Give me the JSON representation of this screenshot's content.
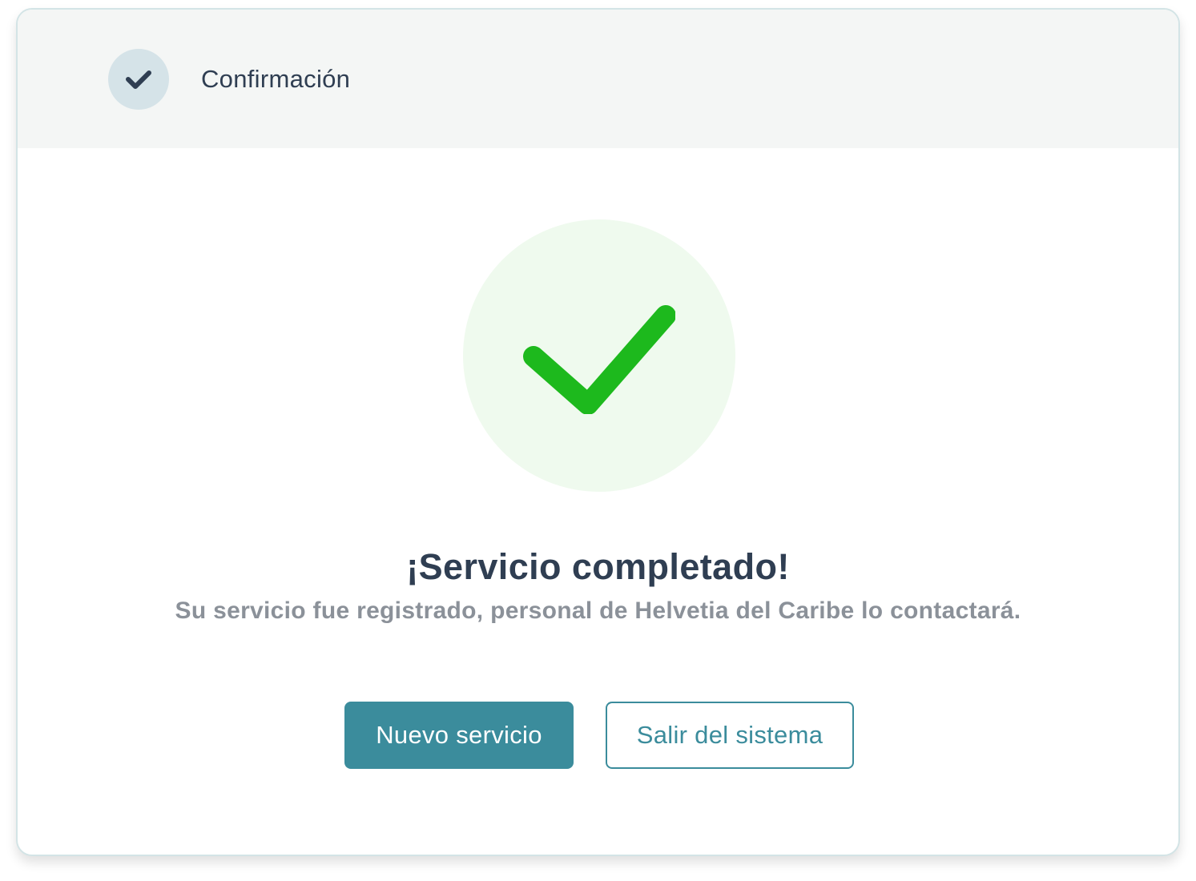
{
  "header": {
    "step_label": "Confirmación",
    "step_icon": "check-icon",
    "badge_color": "#d5e3e8",
    "icon_color": "#2f3e52"
  },
  "main": {
    "success_icon": "check-icon",
    "success_color": "#1db91d",
    "success_bg": "#effaee",
    "title": "¡Servicio completado!",
    "subtitle": "Su servicio fue registrado, personal de Helvetia del Caribe lo contactará."
  },
  "actions": {
    "primary_label": "Nuevo servicio",
    "secondary_label": "Salir del sistema",
    "accent_color": "#3b8c9c"
  }
}
